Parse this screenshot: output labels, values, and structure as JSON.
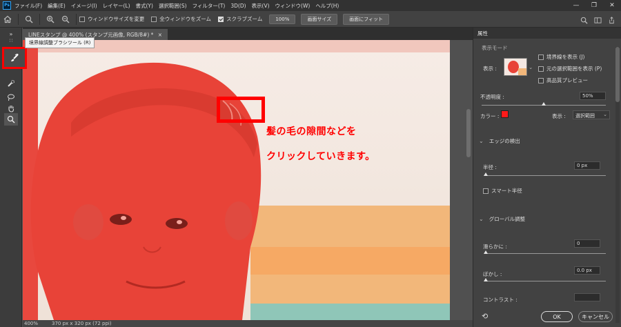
{
  "menubar": {
    "items": [
      "ファイル(F)",
      "編集(E)",
      "イメージ(I)",
      "レイヤー(L)",
      "書式(Y)",
      "選択範囲(S)",
      "フィルター(T)",
      "3D(D)",
      "表示(V)",
      "ウィンドウ(W)",
      "ヘルプ(H)"
    ],
    "minimize": "—",
    "restore": "❐",
    "close": "✕"
  },
  "optbar": {
    "resize_windows": "ウィンドウサイズを変更",
    "zoom_all": "全ウィンドウをズーム",
    "scrubby_zoom": "スクラブズーム",
    "zoom_value": "100%",
    "fit_screen": "画面サイズ",
    "fill_screen": "画面にフィット"
  },
  "tooltip": "境界線調整ブラシツール (R)",
  "document": {
    "tab_title": "LINEスタンプ @ 400% (スタンプ元画像, RGB/8#) *",
    "tab_close": "×",
    "status_zoom": "400%",
    "status_size": "370 px x 320 px (72 ppi)"
  },
  "annotation": {
    "line1": "髪の毛の隙間などを",
    "line2": "クリックしていきます。"
  },
  "panel": {
    "title": "属性",
    "view_mode_label": "表示モード",
    "view_label": "表示 :",
    "show_edge": "境界線を表示 (J)",
    "show_original": "元の選択範囲を表示 (P)",
    "high_quality": "高品質プレビュー",
    "opacity_label": "不透明度 :",
    "opacity_value": "50%",
    "opacity_level": 0.5,
    "color_label": "カラー :",
    "overlay_color": "#ff1a1a",
    "display_label": "表示 :",
    "display_value": "選択範囲",
    "edge_detection": "エッジの検出",
    "radius_label": "半径 :",
    "radius_value": "0 px",
    "smart_radius": "スマート半径",
    "global_refinements": "グローバル調整",
    "smooth_label": "滑らかに :",
    "smooth_value": "0",
    "feather_label": "ぼかし :",
    "feather_value": "0.0 px",
    "contrast_label": "コントラスト :",
    "ok": "OK",
    "cancel": "キャンセル"
  },
  "colors": {
    "annotation_red": "#ff0000",
    "overlay_red": "#ea4339"
  }
}
